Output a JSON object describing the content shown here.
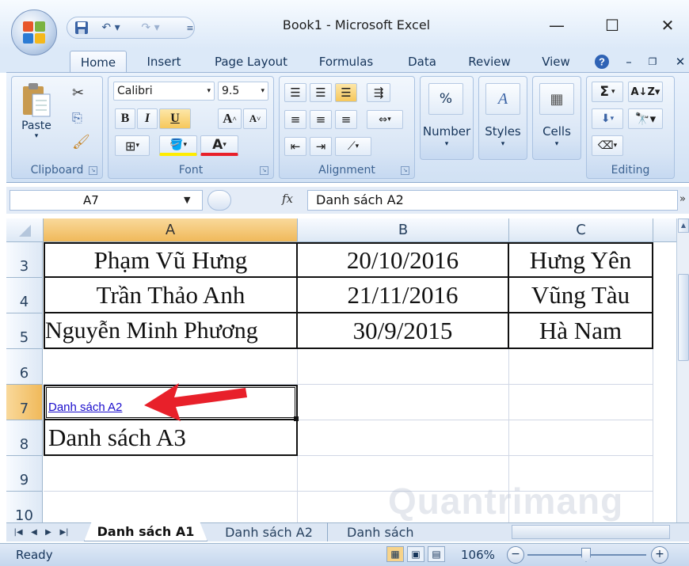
{
  "window": {
    "title": "Book1 - Microsoft Excel"
  },
  "tabs": [
    "Home",
    "Insert",
    "Page Layout",
    "Formulas",
    "Data",
    "Review",
    "View"
  ],
  "ribbon": {
    "clipboard": {
      "label": "Clipboard",
      "paste": "Paste"
    },
    "font": {
      "label": "Font",
      "name": "Calibri",
      "size": "9.5",
      "bold": "B",
      "italic": "I",
      "underline": "U"
    },
    "alignment": {
      "label": "Alignment"
    },
    "number": {
      "label": "Number",
      "symbol": "%"
    },
    "styles": {
      "label": "Styles"
    },
    "cells": {
      "label": "Cells"
    },
    "editing": {
      "label": "Editing",
      "sum": "Σ"
    }
  },
  "formula_bar": {
    "name_box": "A7",
    "fx": "fx",
    "value": "Danh sách A2"
  },
  "columns": [
    "A",
    "B",
    "C"
  ],
  "rows": [
    {
      "num": "3",
      "a": "Phạm Vũ Hưng",
      "b": "20/10/2016",
      "c": "Hưng Yên"
    },
    {
      "num": "4",
      "a": "Trần Thảo Anh",
      "b": "21/11/2016",
      "c": "Vũng Tàu"
    },
    {
      "num": "5",
      "a": "Nguyễn Minh Phương",
      "b": "30/9/2015",
      "c": "Hà Nam"
    },
    {
      "num": "6",
      "a": "",
      "b": "",
      "c": ""
    },
    {
      "num": "7",
      "a": "Danh sách A2",
      "b": "",
      "c": ""
    },
    {
      "num": "8",
      "a": "Danh sách A3",
      "b": "",
      "c": ""
    },
    {
      "num": "9",
      "a": "",
      "b": "",
      "c": ""
    },
    {
      "num": "10",
      "a": "",
      "b": "",
      "c": ""
    }
  ],
  "sheets": [
    "Danh sách A1",
    "Danh sách A2",
    "Danh sách"
  ],
  "status": {
    "ready": "Ready",
    "zoom": "106%"
  },
  "colors": {
    "accent": "#f0b95a",
    "hyperlink": "#1a0dcc",
    "arrow": "#e8202a"
  },
  "watermark": "Quantrimang"
}
